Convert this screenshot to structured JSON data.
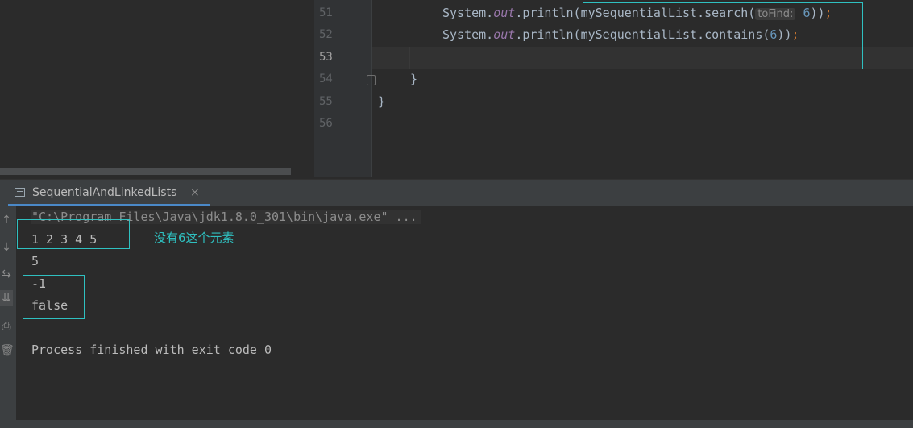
{
  "editor": {
    "line_numbers": [
      "51",
      "52",
      "53",
      "54",
      "55",
      "56"
    ],
    "line51": {
      "pre": "System.",
      "out": "out",
      "method": ".println(mySequentialList.search(",
      "hint": "toFind:",
      "arg": "6",
      "close": "))",
      "semi": ";"
    },
    "line52": {
      "pre": "System.",
      "out": "out",
      "method": ".println(mySequentialList.contains(",
      "arg": "6",
      "close": "))",
      "semi": ";"
    },
    "line54": "}",
    "line55": "}"
  },
  "run_panel": {
    "tab_label": "SequentialAndLinkedLists",
    "tab_close": "×"
  },
  "toolbar": {
    "up_icon": "↑",
    "down_icon": "↓",
    "wrap_icon": "⇆",
    "scroll_end_icon": "⇊",
    "print_icon": "⎙",
    "trash_icon": "🗑"
  },
  "console": {
    "command": "\"C:\\Program Files\\Java\\jdk1.8.0_301\\bin\\java.exe\" ...",
    "lines": [
      "1 2 3 4 5",
      "5",
      "-1",
      "false",
      "",
      "Process finished with exit code 0"
    ]
  },
  "annotation": {
    "note": "没有6这个元素"
  },
  "colors": {
    "highlight": "#2fc0c0",
    "background": "#2b2b2b"
  }
}
